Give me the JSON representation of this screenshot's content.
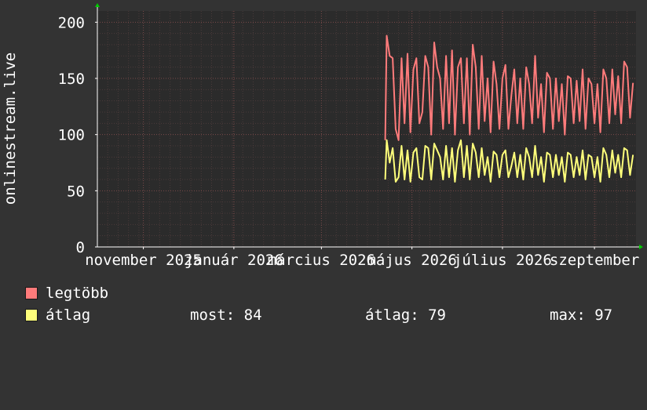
{
  "chart_data": {
    "type": "line",
    "ylabel": "onlinestream.live",
    "ylim": [
      0,
      210
    ],
    "yticks": [
      0,
      50,
      100,
      150,
      200
    ],
    "xlim": [
      "2025-10-01",
      "2026-09-29"
    ],
    "xticks": [
      {
        "label": "november 2025",
        "date": "2025-11-01"
      },
      {
        "label": "január 2026",
        "date": "2026-01-01"
      },
      {
        "label": "március 2026",
        "date": "2026-03-01"
      },
      {
        "label": "május 2026",
        "date": "2026-05-01"
      },
      {
        "label": "július 2026",
        "date": "2026-07-01"
      },
      {
        "label": "szeptember",
        "date": "2026-09-01"
      }
    ],
    "grid": true,
    "background": "#2b2b2b",
    "series": [
      {
        "name": "legtöbb",
        "color": "#ff7b7b",
        "x": [
          "2026-04-13",
          "2026-04-14",
          "2026-04-16",
          "2026-04-18",
          "2026-04-20",
          "2026-04-22",
          "2026-04-24",
          "2026-04-26",
          "2026-04-28",
          "2026-04-30",
          "2026-05-02",
          "2026-05-04",
          "2026-05-06",
          "2026-05-08",
          "2026-05-10",
          "2026-05-12",
          "2026-05-14",
          "2026-05-16",
          "2026-05-18",
          "2026-05-20",
          "2026-05-22",
          "2026-05-24",
          "2026-05-26",
          "2026-05-28",
          "2026-05-30",
          "2026-06-01",
          "2026-06-03",
          "2026-06-05",
          "2026-06-07",
          "2026-06-09",
          "2026-06-11",
          "2026-06-13",
          "2026-06-15",
          "2026-06-17",
          "2026-06-19",
          "2026-06-21",
          "2026-06-23",
          "2026-06-25",
          "2026-06-27",
          "2026-06-29",
          "2026-07-01",
          "2026-07-03",
          "2026-07-05",
          "2026-07-07",
          "2026-07-09",
          "2026-07-11",
          "2026-07-13",
          "2026-07-15",
          "2026-07-17",
          "2026-07-19",
          "2026-07-21",
          "2026-07-23",
          "2026-07-25",
          "2026-07-27",
          "2026-07-29",
          "2026-07-31",
          "2026-08-02",
          "2026-08-04",
          "2026-08-06",
          "2026-08-08",
          "2026-08-10",
          "2026-08-12",
          "2026-08-14",
          "2026-08-16",
          "2026-08-18",
          "2026-08-20",
          "2026-08-22",
          "2026-08-24",
          "2026-08-26",
          "2026-08-28",
          "2026-08-30",
          "2026-09-01",
          "2026-09-03",
          "2026-09-05",
          "2026-09-07",
          "2026-09-09",
          "2026-09-11",
          "2026-09-13",
          "2026-09-15",
          "2026-09-17",
          "2026-09-19",
          "2026-09-21",
          "2026-09-23",
          "2026-09-25",
          "2026-09-27"
        ],
        "values": [
          95,
          188,
          170,
          168,
          105,
          95,
          168,
          110,
          172,
          102,
          158,
          168,
          110,
          120,
          170,
          160,
          100,
          182,
          160,
          150,
          105,
          170,
          110,
          175,
          100,
          160,
          168,
          110,
          168,
          100,
          180,
          160,
          105,
          170,
          112,
          150,
          102,
          165,
          145,
          105,
          150,
          162,
          105,
          135,
          158,
          110,
          150,
          105,
          160,
          145,
          110,
          170,
          115,
          145,
          102,
          155,
          150,
          105,
          150,
          112,
          145,
          100,
          152,
          150,
          110,
          148,
          112,
          158,
          105,
          150,
          145,
          110,
          145,
          102,
          158,
          150,
          110,
          158,
          118,
          152,
          110,
          165,
          160,
          115,
          146
        ]
      },
      {
        "name": "átlag",
        "color": "#ffff7b",
        "x": [
          "2026-04-13",
          "2026-04-14",
          "2026-04-16",
          "2026-04-18",
          "2026-04-20",
          "2026-04-22",
          "2026-04-24",
          "2026-04-26",
          "2026-04-28",
          "2026-04-30",
          "2026-05-02",
          "2026-05-04",
          "2026-05-06",
          "2026-05-08",
          "2026-05-10",
          "2026-05-12",
          "2026-05-14",
          "2026-05-16",
          "2026-05-18",
          "2026-05-20",
          "2026-05-22",
          "2026-05-24",
          "2026-05-26",
          "2026-05-28",
          "2026-05-30",
          "2026-06-01",
          "2026-06-03",
          "2026-06-05",
          "2026-06-07",
          "2026-06-09",
          "2026-06-11",
          "2026-06-13",
          "2026-06-15",
          "2026-06-17",
          "2026-06-19",
          "2026-06-21",
          "2026-06-23",
          "2026-06-25",
          "2026-06-27",
          "2026-06-29",
          "2026-07-01",
          "2026-07-03",
          "2026-07-05",
          "2026-07-07",
          "2026-07-09",
          "2026-07-11",
          "2026-07-13",
          "2026-07-15",
          "2026-07-17",
          "2026-07-19",
          "2026-07-21",
          "2026-07-23",
          "2026-07-25",
          "2026-07-27",
          "2026-07-29",
          "2026-07-31",
          "2026-08-02",
          "2026-08-04",
          "2026-08-06",
          "2026-08-08",
          "2026-08-10",
          "2026-08-12",
          "2026-08-14",
          "2026-08-16",
          "2026-08-18",
          "2026-08-20",
          "2026-08-22",
          "2026-08-24",
          "2026-08-26",
          "2026-08-28",
          "2026-08-30",
          "2026-09-01",
          "2026-09-03",
          "2026-09-05",
          "2026-09-07",
          "2026-09-09",
          "2026-09-11",
          "2026-09-13",
          "2026-09-15",
          "2026-09-17",
          "2026-09-19",
          "2026-09-21",
          "2026-09-23",
          "2026-09-25",
          "2026-09-27"
        ],
        "values": [
          60,
          95,
          75,
          88,
          58,
          62,
          90,
          60,
          86,
          58,
          84,
          88,
          62,
          60,
          90,
          88,
          60,
          92,
          86,
          80,
          60,
          90,
          62,
          88,
          58,
          86,
          95,
          62,
          90,
          60,
          92,
          84,
          62,
          88,
          64,
          80,
          58,
          85,
          82,
          62,
          82,
          86,
          62,
          72,
          84,
          62,
          82,
          60,
          88,
          80,
          62,
          90,
          64,
          80,
          58,
          84,
          82,
          62,
          82,
          64,
          80,
          58,
          84,
          82,
          62,
          80,
          64,
          86,
          60,
          82,
          80,
          62,
          80,
          58,
          88,
          82,
          62,
          86,
          66,
          82,
          62,
          88,
          86,
          64,
          82
        ]
      }
    ]
  },
  "legend": {
    "max_label": "legtöbb",
    "avg_label": "átlag",
    "stats": {
      "current_label": "most:",
      "current_value": "84",
      "avg_label": "átlag:",
      "avg_value": "79",
      "max_label": "max:",
      "max_value": "97"
    }
  }
}
